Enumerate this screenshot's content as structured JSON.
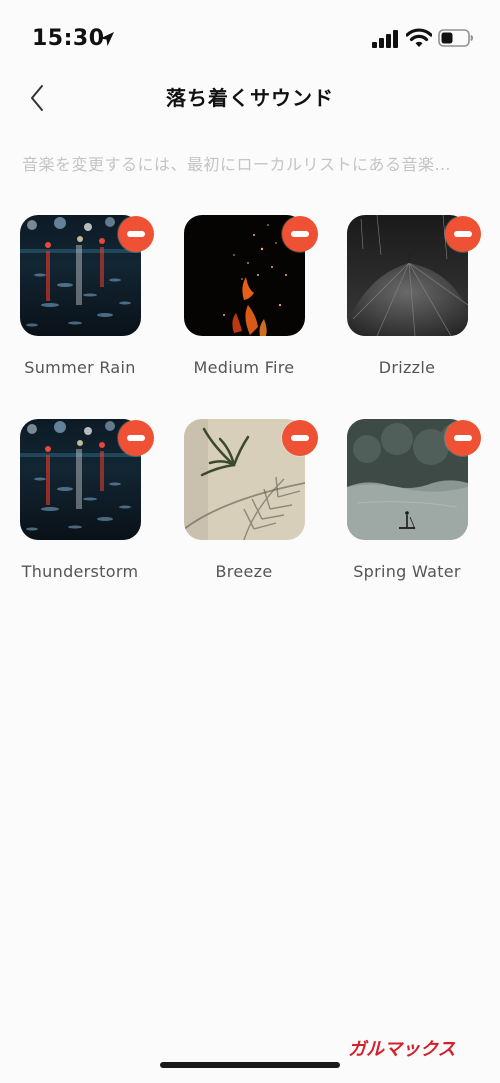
{
  "status_bar": {
    "time": "15:30",
    "icons": [
      "location-arrow-icon",
      "signal-icon",
      "wifi-icon",
      "battery-icon"
    ]
  },
  "header": {
    "back_icon": "chevron-left-icon",
    "title": "落ち着くサウンド"
  },
  "hint": "音楽を変更するには、最初にローカルリストにある音楽…",
  "sounds": [
    {
      "label": "Summer Rain",
      "image": "rainy-night-street"
    },
    {
      "label": "Medium Fire",
      "image": "fire-embers"
    },
    {
      "label": "Drizzle",
      "image": "black-umbrella"
    },
    {
      "label": "Thunderstorm",
      "image": "rainy-night-street"
    },
    {
      "label": "Breeze",
      "image": "palm-leaf-shadow"
    },
    {
      "label": "Spring Water",
      "image": "lake-with-person"
    }
  ],
  "remove_icon": "minus-circle-icon",
  "colors": {
    "remove": "#ee5133",
    "background": "#fbfbfb",
    "hint": "#c4c4c4"
  },
  "watermark": {
    "text": "ガルマックス",
    "color": "#d3202a"
  }
}
